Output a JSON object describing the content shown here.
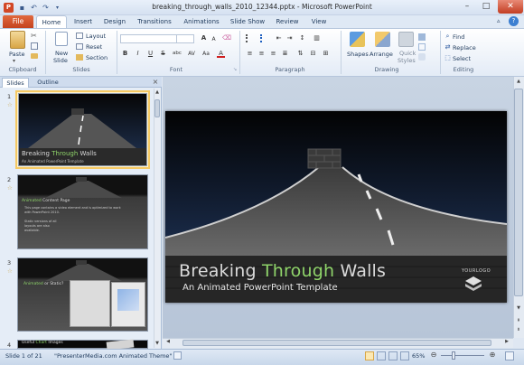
{
  "window": {
    "title": "breaking_through_walls_2010_12344.pptx - Microsoft PowerPoint",
    "app_icon_letter": "P"
  },
  "tabs": {
    "file": "File",
    "items": [
      "Home",
      "Insert",
      "Design",
      "Transitions",
      "Animations",
      "Slide Show",
      "Review",
      "View"
    ]
  },
  "ribbon": {
    "clipboard": {
      "paste": "Paste",
      "label": "Clipboard"
    },
    "slides": {
      "new_slide_1": "New",
      "new_slide_2": "Slide",
      "layout": "Layout",
      "reset": "Reset",
      "section": "Section",
      "label": "Slides"
    },
    "font": {
      "label": "Font",
      "bold": "B",
      "italic": "I",
      "underline": "U",
      "strike": "S",
      "shadow": "abc",
      "spacing": "AV",
      "case": "Aa",
      "color": "A",
      "grow": "A",
      "shrink": "A"
    },
    "paragraph": {
      "label": "Paragraph"
    },
    "drawing": {
      "shapes": "Shapes",
      "arrange": "Arrange",
      "quick_styles_1": "Quick",
      "quick_styles_2": "Styles",
      "label": "Drawing"
    },
    "editing": {
      "find": "Find",
      "replace": "Replace",
      "select": "Select",
      "label": "Editing"
    }
  },
  "pane": {
    "tab_slides": "Slides",
    "tab_outline": "Outline",
    "slides": [
      {
        "num": "1",
        "title_a": "Breaking",
        "title_b": "Through",
        "title_c": "Walls",
        "subtitle": "An Animated PowerPoint Template"
      },
      {
        "num": "2",
        "heading_a": "Animated",
        "heading_b": "Content",
        "heading_c": "Page",
        "body_1": "This page contains a video element and is optimized to work",
        "body_2": "with PowerPoint 2010.",
        "body_3": "Static versions of all",
        "body_4": "layouts are also",
        "body_5": "available."
      },
      {
        "num": "3",
        "heading_a": "Animated",
        "heading_b": "or Static?"
      },
      {
        "num": "4",
        "heading_a": "Useful",
        "heading_b": "Chart",
        "heading_c": "Images"
      }
    ]
  },
  "slide": {
    "title_a": "Breaking",
    "title_b": "Through",
    "title_c": "Walls",
    "subtitle": "An Animated PowerPoint Template",
    "logo": "YOURLOGO",
    "title_colors": {
      "white": "#d9d9d9",
      "green": "#8fd46a"
    }
  },
  "status": {
    "slide": "Slide 1 of 21",
    "theme": "\"PresenterMedia.com Animated Theme\"",
    "zoom": "65%"
  },
  "colors": {
    "file_tab": "#d24726",
    "accent": "#1e395b"
  }
}
